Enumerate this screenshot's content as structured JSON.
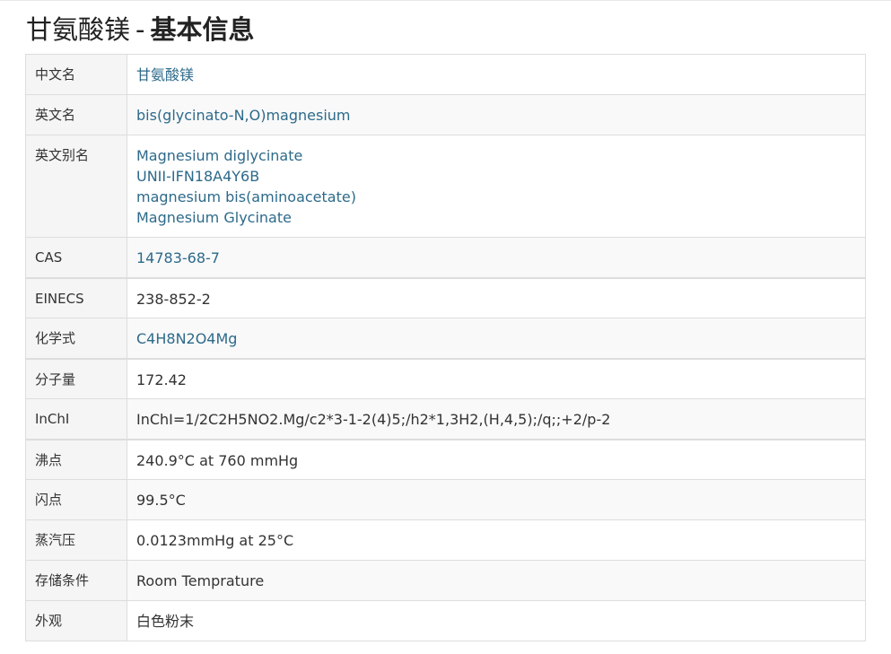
{
  "heading": {
    "name": "甘氨酸镁",
    "separator": "-",
    "title": "基本信息"
  },
  "rows": [
    {
      "label": "中文名",
      "values": [
        "甘氨酸镁"
      ],
      "link": true
    },
    {
      "label": "英文名",
      "values": [
        "bis(glycinato-N,O)magnesium"
      ],
      "link": true
    },
    {
      "label": "英文别名",
      "values": [
        "Magnesium diglycinate",
        "UNII-IFN18A4Y6B",
        "magnesium bis(aminoacetate)",
        "Magnesium Glycinate"
      ],
      "link": true
    },
    {
      "label": "CAS",
      "values": [
        "14783-68-7"
      ],
      "link": true
    },
    {
      "label": "EINECS",
      "values": [
        "238-852-2"
      ],
      "link": false
    },
    {
      "label": "化学式",
      "values": [
        "C4H8N2O4Mg"
      ],
      "link": true
    },
    {
      "label": "分子量",
      "values": [
        "172.42"
      ],
      "link": false
    },
    {
      "label": "InChI",
      "values": [
        "InChI=1/2C2H5NO2.Mg/c2*3-1-2(4)5;/h2*1,3H2,(H,4,5);/q;;+2/p-2"
      ],
      "link": false
    },
    {
      "label": "沸点",
      "values": [
        "240.9°C at 760 mmHg"
      ],
      "link": false
    },
    {
      "label": "闪点",
      "values": [
        "99.5°C"
      ],
      "link": false
    },
    {
      "label": "蒸汽压",
      "values": [
        "0.0123mmHg at 25°C"
      ],
      "link": false
    },
    {
      "label": "存储条件",
      "values": [
        "Room Temprature"
      ],
      "link": false
    },
    {
      "label": "外观",
      "values": [
        "白色粉末"
      ],
      "link": false
    }
  ]
}
